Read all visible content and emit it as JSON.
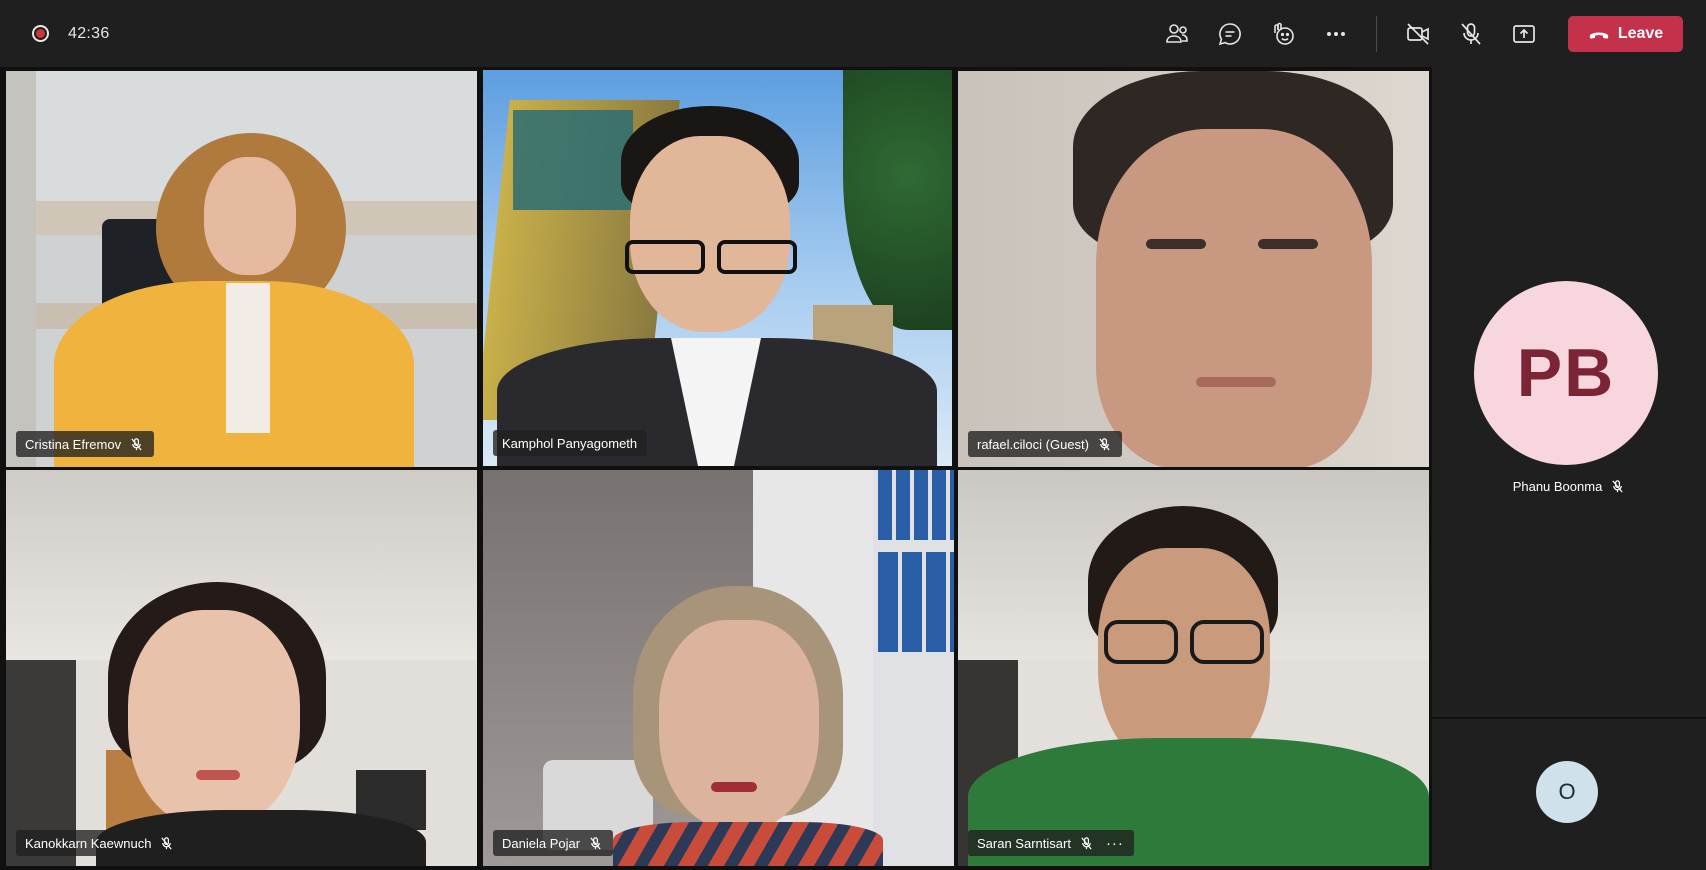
{
  "meeting": {
    "timer": "42:36"
  },
  "toolbar": {
    "participants_icon": "people-icon",
    "chat_icon": "chat-icon",
    "reactions_icon": "reaction-icon",
    "more_icon": "more-icon",
    "camera_icon": "camera-off-icon",
    "mic_icon": "mic-off-icon",
    "share_icon": "share-tray-icon",
    "leave_label": "Leave",
    "leave_color": "#c4314b"
  },
  "participants": [
    {
      "name": "Cristina Efremov"
    },
    {
      "name": "Kamphol Panyagometh"
    },
    {
      "name": "rafael.ciloci (Guest)"
    },
    {
      "name": "Kanokkarn Kaewnuch"
    },
    {
      "name": "Daniela Pojar"
    },
    {
      "name": "Saran Sarntisart",
      "more": "···"
    }
  ],
  "rail": {
    "avatar_initials": "PB",
    "avatar_name": "Phanu Boonma",
    "overflow_initial": "O"
  },
  "colors": {
    "active_speaker": "#8e8fe8",
    "avatar_pb_bg": "#f7d6dd",
    "avatar_pb_text": "#7b2436"
  }
}
